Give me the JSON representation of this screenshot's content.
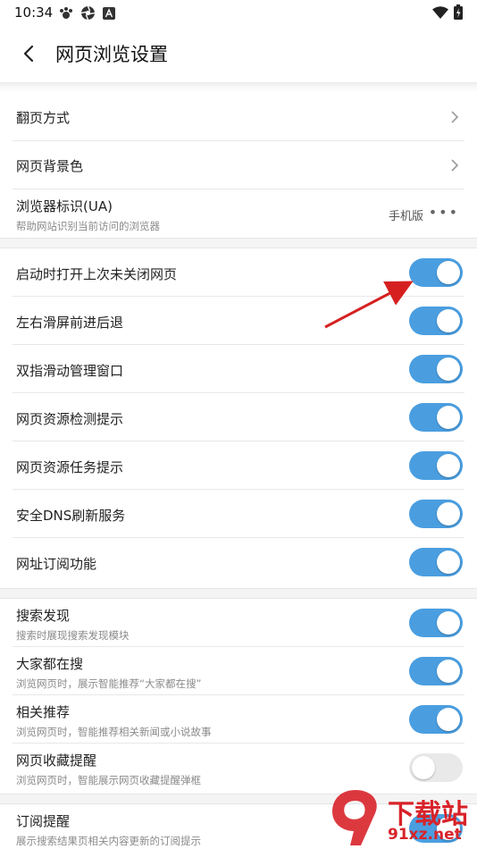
{
  "status_bar": {
    "time": "10:34",
    "left_icons": [
      "paw-app-icon",
      "aperture-app-icon",
      "a-app-icon"
    ],
    "right_icons": [
      "wifi-icon",
      "battery-icon"
    ]
  },
  "header": {
    "title": "网页浏览设置",
    "back_icon": "back-chevron-icon"
  },
  "group1": {
    "items": [
      {
        "title": "翻页方式",
        "type": "nav"
      },
      {
        "title": "网页背景色",
        "type": "nav"
      },
      {
        "title": "浏览器标识(UA)",
        "subtitle": "帮助网站识别当前访问的浏览器",
        "value": "手机版",
        "more": "•••"
      }
    ]
  },
  "group2": {
    "items": [
      {
        "title": "启动时打开上次未关闭网页",
        "on": true
      },
      {
        "title": "左右滑屏前进后退",
        "on": true
      },
      {
        "title": "双指滑动管理窗口",
        "on": true
      },
      {
        "title": "网页资源检测提示",
        "on": true
      },
      {
        "title": "网页资源任务提示",
        "on": true
      },
      {
        "title": "安全DNS刷新服务",
        "on": true
      },
      {
        "title": "网址订阅功能",
        "on": true
      }
    ]
  },
  "group3": {
    "items": [
      {
        "title": "搜索发现",
        "subtitle": "搜索时展现搜索发现模块",
        "on": true
      },
      {
        "title": "大家都在搜",
        "subtitle": "浏览网页时，展示智能推荐“大家都在搜”",
        "on": true
      },
      {
        "title": "相关推荐",
        "subtitle": "浏览网页时，智能推荐相关新闻或小说故事",
        "on": true
      },
      {
        "title": "网页收藏提醒",
        "subtitle": "浏览网页时，智能展示网页收藏提醒弹框",
        "on": false
      }
    ]
  },
  "group4": {
    "items": [
      {
        "title": "订阅提醒",
        "subtitle": "展示搜索结果页相关内容更新的订阅提示",
        "on": true
      }
    ]
  },
  "watermark": {
    "line1": "下载站",
    "line2": "91xz.net"
  },
  "colors": {
    "toggle_on": "#4a9ee0",
    "toggle_off": "#e9e9e9",
    "annotation_arrow": "#d62020",
    "watermark": "#d8232a"
  }
}
